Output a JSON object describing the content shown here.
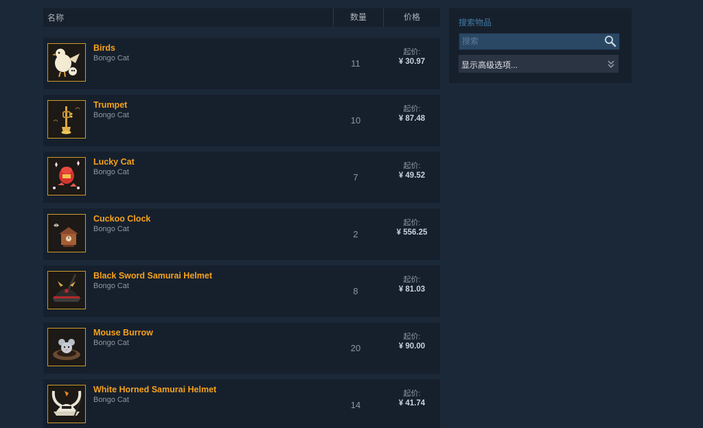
{
  "table": {
    "header": {
      "name": "名称",
      "quantity": "数量",
      "price": "价格"
    },
    "rows": [
      {
        "title": "Birds",
        "game": "Bongo Cat",
        "quantity": "11",
        "price_label": "起价:",
        "price": "¥ 30.97",
        "icon": "birds-icon"
      },
      {
        "title": "Trumpet",
        "game": "Bongo Cat",
        "quantity": "10",
        "price_label": "起价:",
        "price": "¥ 87.48",
        "icon": "trumpet-icon"
      },
      {
        "title": "Lucky Cat",
        "game": "Bongo Cat",
        "quantity": "7",
        "price_label": "起价:",
        "price": "¥ 49.52",
        "icon": "lucky-cat-icon"
      },
      {
        "title": "Cuckoo Clock",
        "game": "Bongo Cat",
        "quantity": "2",
        "price_label": "起价:",
        "price": "¥ 556.25",
        "icon": "cuckoo-clock-icon"
      },
      {
        "title": "Black Sword Samurai Helmet",
        "game": "Bongo Cat",
        "quantity": "8",
        "price_label": "起价:",
        "price": "¥ 81.03",
        "icon": "black-samurai-helmet-icon"
      },
      {
        "title": "Mouse Burrow",
        "game": "Bongo Cat",
        "quantity": "20",
        "price_label": "起价:",
        "price": "¥ 90.00",
        "icon": "mouse-burrow-icon"
      },
      {
        "title": "White Horned Samurai Helmet",
        "game": "Bongo Cat",
        "quantity": "14",
        "price_label": "起价:",
        "price": "¥ 41.74",
        "icon": "white-samurai-helmet-icon"
      }
    ]
  },
  "search": {
    "title": "搜索物品",
    "placeholder": "搜索",
    "value": "",
    "advanced_label": "显示高级选项..."
  },
  "colors": {
    "background": "#1b2838",
    "panel": "#16202d",
    "item_title": "#f7a21b",
    "thumb_border": "#cf9c2a",
    "search_title": "#417aa5"
  }
}
